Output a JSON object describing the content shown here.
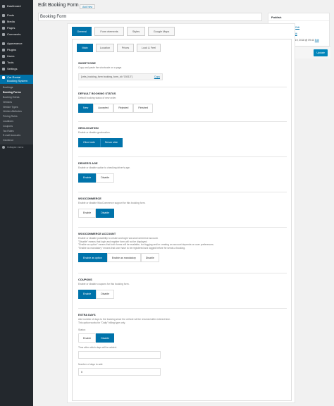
{
  "menu": {
    "items": [
      {
        "label": "Dashboard",
        "icon": "dashboard-icon"
      },
      {
        "label": "Posts",
        "icon": "pin-icon"
      },
      {
        "label": "Media",
        "icon": "media-icon"
      },
      {
        "label": "Pages",
        "icon": "page-icon"
      },
      {
        "label": "Comments",
        "icon": "comment-icon"
      },
      {
        "label": "Appearance",
        "icon": "brush-icon"
      },
      {
        "label": "Plugins",
        "icon": "plug-icon"
      },
      {
        "label": "Users",
        "icon": "user-icon"
      },
      {
        "label": "Tools",
        "icon": "wrench-icon"
      },
      {
        "label": "Settings",
        "icon": "settings-icon"
      }
    ],
    "active": {
      "label_line1": "Car Rental",
      "label_line2": "Booking System",
      "icon": "car-icon"
    },
    "submenu": [
      "Bookings",
      "Booking Forms",
      "Booking Extras",
      "Vehicles",
      "Vehicle Types",
      "Vehicle Attributes",
      "Pricing Rules",
      "Locations",
      "Coupons",
      "Tax Rates",
      "E-mail Accounts",
      "Geofence"
    ],
    "collapse_label": "Collapse menu"
  },
  "page": {
    "title": "Edit Booking Form",
    "add_new": "Add New",
    "post_title": "Booking Form"
  },
  "tabs_main": [
    "General",
    "Form elements",
    "Styles",
    "Google Maps"
  ],
  "tabs_sub": [
    "Main",
    "Location",
    "Prices",
    "Look & Feel"
  ],
  "sections": {
    "shortcode": {
      "title": "SHORTCODE",
      "desc": "Copy and paste the shortcode on a page.",
      "code": "[crbs_booking_form booking_form_id=\"15013\"]",
      "copy": "Copy"
    },
    "default_status": {
      "title": "DEFAULT BOOKING STATUS",
      "desc": "Default booking status of new order.",
      "options": [
        "New",
        "Accepted",
        "Rejected",
        "Finished"
      ],
      "selected": "New"
    },
    "geolocation": {
      "title": "GEOLOCATION",
      "desc": "Enable or disable geolocation.",
      "options": [
        "Client side",
        "Server side"
      ],
      "selected": [
        "Client side",
        "Server side"
      ]
    },
    "drivers_age": {
      "title": "DRIVER'S AGE",
      "desc": "Enable or disable option to checking driver's age.",
      "options": [
        "Enable",
        "Disable"
      ],
      "selected": "Enable"
    },
    "woocommerce": {
      "title": "WOOCOMMERCE",
      "desc": "Enable or disable WooCommerce support for this booking form.",
      "options": [
        "Enable",
        "Disable"
      ],
      "selected": "Disable"
    },
    "woocommerce_account": {
      "title": "WOOCOMMERCE ACCOUNT",
      "desc_lines": [
        "Enable or disable possibility to create and login via wooCommerce account.",
        "\"Disable\" means that login and register form will not be displayed.",
        "\"Enable as option\" means that both forms will be available, but logging and/or creating an account depends on user preferences.",
        "\"Enable as mandatory\" means that user have to be registered and logged before he sends a booking."
      ],
      "options": [
        "Enable as option",
        "Enable as mandatory",
        "Disable"
      ],
      "selected": "Enable as option"
    },
    "coupons": {
      "title": "COUPONS",
      "desc": "Enable or disable coupons for this booking form.",
      "options": [
        "Enable",
        "Disable"
      ],
      "selected": "Enable"
    },
    "extra_days": {
      "title": "EXTRA DAYS",
      "desc_lines": [
        "Add number of days to the booking since the vehicle will be returned after entered time.",
        "This option works for \"Daily\" billing type only."
      ],
      "status_label": "Status:",
      "options": [
        "Enable",
        "Disable"
      ],
      "selected": "Disable",
      "time_label": "Time after which days will be added:",
      "time_value": "",
      "days_label": "Number of days to add:",
      "days_value": "0"
    }
  },
  "publish": {
    "title": "Publish",
    "status_label": "Status:",
    "status_value": "Published",
    "visibility_label": "Visibility:",
    "visibility_value": "Public",
    "published_label": "Published on: Mar 19, 2018 @ 09:43",
    "edit": "Edit",
    "trash": "Move to Trash",
    "update": "Update"
  },
  "colors": {
    "accent": "#0073aa",
    "menu_bg": "#23282d",
    "submenu_bg": "#32373c"
  }
}
